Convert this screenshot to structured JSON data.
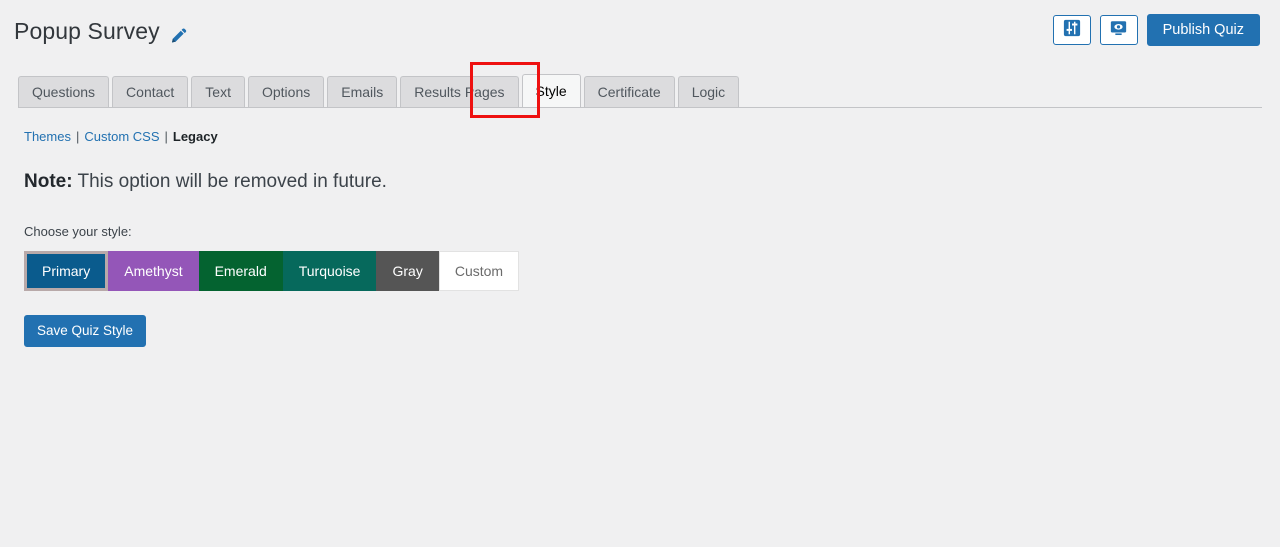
{
  "header": {
    "title": "Popup Survey",
    "edit_icon": "pencil-icon",
    "actions": {
      "settings_icon": "sliders-icon",
      "preview_icon": "monitor-eye-icon",
      "publish_label": "Publish Quiz"
    }
  },
  "tabs": [
    {
      "label": "Questions",
      "active": false
    },
    {
      "label": "Contact",
      "active": false
    },
    {
      "label": "Text",
      "active": false
    },
    {
      "label": "Options",
      "active": false
    },
    {
      "label": "Emails",
      "active": false
    },
    {
      "label": "Results Pages",
      "active": false
    },
    {
      "label": "Style",
      "active": true
    },
    {
      "label": "Certificate",
      "active": false
    },
    {
      "label": "Logic",
      "active": false
    }
  ],
  "subnav": {
    "items": [
      {
        "label": "Themes",
        "current": false
      },
      {
        "label": "Custom CSS",
        "current": false
      },
      {
        "label": "Legacy",
        "current": true
      }
    ],
    "separator": "|"
  },
  "main": {
    "note_prefix": "Note:",
    "note_text": " This option will be removed in future.",
    "choose_label": "Choose your style:",
    "styles": [
      {
        "label": "Primary",
        "color": "#0a5b8d",
        "text_color": "#ffffff",
        "selected": true
      },
      {
        "label": "Amethyst",
        "color": "#9456b8",
        "text_color": "#ffffff",
        "selected": false
      },
      {
        "label": "Emerald",
        "color": "#046330",
        "text_color": "#ffffff",
        "selected": false
      },
      {
        "label": "Turquoise",
        "color": "#06695c",
        "text_color": "#ffffff",
        "selected": false
      },
      {
        "label": "Gray",
        "color": "#555555",
        "text_color": "#ffffff",
        "selected": false
      },
      {
        "label": "Custom",
        "color": "#ffffff",
        "text_color": "#6b6b6b",
        "selected": false
      }
    ],
    "save_label": "Save Quiz Style"
  },
  "annotation": {
    "highlight_target": "Style",
    "highlight_color": "#ee1111"
  },
  "colors": {
    "background": "#f0f0f1",
    "accent_blue": "#2271b1",
    "link_blue": "#2271b1",
    "tab_inactive": "#dcdcde",
    "tab_active": "#f6f7f7"
  }
}
